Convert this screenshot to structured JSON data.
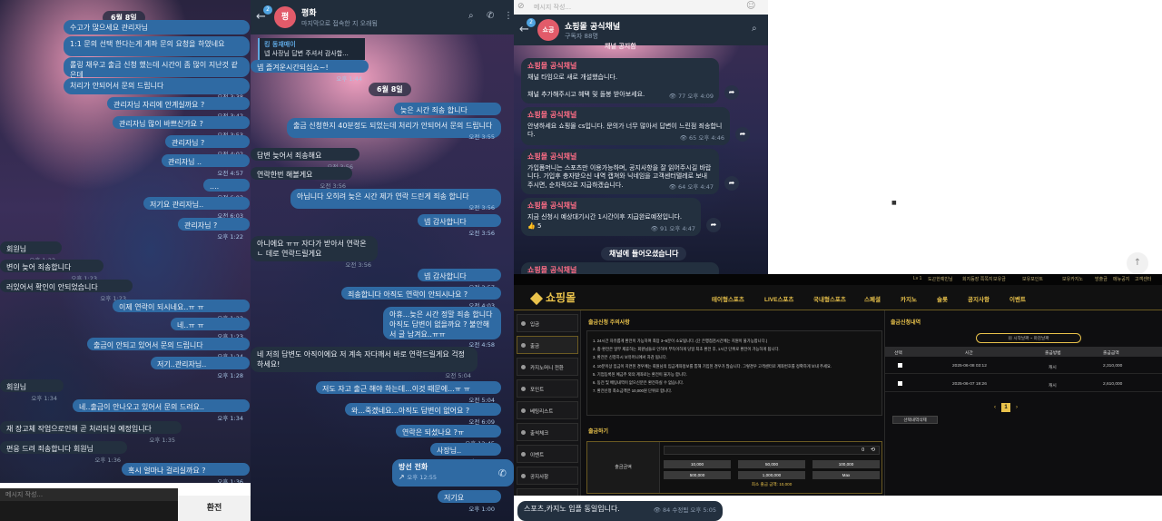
{
  "pane1": {
    "date": "6월 8일",
    "input_placeholder": "메시지 작성...",
    "exchange_button": "환전",
    "messages": [
      {
        "dir": "out",
        "text": "수고가 많으세요 관리자님",
        "time": ""
      },
      {
        "dir": "out",
        "text": "1:1 문의 선택 한다는게 계좌 문의 요청을 하였네요",
        "time": ""
      },
      {
        "dir": "out",
        "text": "롤링 채우고 출금 신청 했는데 시간이 좀 많이 지난것 같은데",
        "time": ""
      },
      {
        "dir": "out",
        "text": "처리가 안되어서 문의 드립니다",
        "time": "오전 3:38"
      },
      {
        "dir": "out",
        "text": "관리자님 자리에 안계실까요 ?",
        "time": "오전 3:42"
      },
      {
        "dir": "out",
        "text": "관리자님 많이 바쁘신가요 ?",
        "time": "오전 3:53"
      },
      {
        "dir": "out",
        "text": "관리자님 ?",
        "time": "오전 4:02"
      },
      {
        "dir": "out",
        "text": "관리자님 ..",
        "time": "오전 4:57"
      },
      {
        "dir": "out",
        "text": "....",
        "time": "오전 6:03"
      },
      {
        "dir": "out",
        "text": "저기요 관리자님..",
        "time": "오전 6:03"
      },
      {
        "dir": "out",
        "text": "관리자님 ?",
        "time": "오후 1:22"
      },
      {
        "dir": "in",
        "text": "회원님",
        "time": "오후 1:22"
      },
      {
        "dir": "in",
        "text": "변이 늦어 죄송합니다",
        "time": "오후 1:23"
      },
      {
        "dir": "in",
        "text": "러있어서 확인이 안되었습니다",
        "time": "오후 1:23"
      },
      {
        "dir": "out",
        "text": "이제 연락이 되시네요..ㅠ ㅠ",
        "time": "오후 1:23"
      },
      {
        "dir": "out",
        "text": "네..ㅠ ㅠ",
        "time": "오후 1:23"
      },
      {
        "dir": "out",
        "text": "출금이 안되고 있어서 문의 드립니다",
        "time": "오후 1:24"
      },
      {
        "dir": "out",
        "text": "저기..관리자님..",
        "time": "오후 1:28"
      },
      {
        "dir": "in",
        "text": "회원님",
        "time": "오후 1:34"
      },
      {
        "dir": "out",
        "text": "네..출금이 안나오고 있어서 문의 드려요..",
        "time": "오후 1:34"
      },
      {
        "dir": "in",
        "text": "재 장고체 작업으로인해 곧 처리되실 예정입니다",
        "time": "오후 1:35"
      },
      {
        "dir": "in",
        "text": "편응 드려 죄송합니다 회원님",
        "time": "오후 1:36"
      },
      {
        "dir": "out",
        "text": "혹시 얼마나 걸리실까요 ?",
        "time": "오후 1:36"
      }
    ]
  },
  "pane2": {
    "header_badge": "2",
    "avatar_letter": "평",
    "title": "평화",
    "subtitle": "마지막으로 접속한 지 오래됨",
    "pinned_label": "킹 동재매이",
    "pinned_text": "넵 사장님 답변 주셔서 감사합...",
    "date": "6월 8일",
    "messages": [
      {
        "dir": "out",
        "text": "넵 즐겨운시간되십쇼~!",
        "time": "오후 1:44"
      },
      {
        "dir": "out",
        "text": "늦은 시간 죄송 합니다",
        "time": "오전 3:44"
      },
      {
        "dir": "out",
        "text": "출금 신청한지 40분정도 되었는데 처리가 안되어서 문의 드립니다",
        "time": "오전 3:55"
      },
      {
        "dir": "in",
        "text": "답변 늦어서 죄송해요",
        "time": "오전 3:56"
      },
      {
        "dir": "in",
        "text": "연락한번 해볼게요",
        "time": "오전 3:56"
      },
      {
        "dir": "out",
        "text": "아닙니다 오히려 늦은 시간 제가 연락 드린게 죄송 합니다",
        "time": "오전 3:56"
      },
      {
        "dir": "out",
        "text": "넵 감사합니다",
        "time": "오전 3:56"
      },
      {
        "dir": "in",
        "text": "아니에요 ㅠㅠ 자다가 받아서 연락온ㄴ 데로 연락드릴게요",
        "time": "오전 3:56"
      },
      {
        "dir": "out",
        "text": "넵 감사합니다",
        "time": "오전 3:57"
      },
      {
        "dir": "out",
        "text": "죄송합니다 아직도 연락이 안되시나요 ?",
        "time": "오전 4:03"
      },
      {
        "dir": "out",
        "text": "아휴...늦은 시간 정말 죄송 합니다 아직도 답변이 없을까요 ? 불안해서 글 남겨요..ㅠㅠ",
        "time": "오전 4:58"
      },
      {
        "dir": "in",
        "text": "네 저희 답변도 아직이에요 저 계속 자다깨서 바로 연락드릴게요 걱정하세요!",
        "time": "오전 5:04"
      },
      {
        "dir": "out",
        "text": "저도 자고 출근 해야 하는데...이것 때문에...ㅠ ㅠ",
        "time": "오전 5:04"
      },
      {
        "dir": "out",
        "text": "와...죽겠네요...아직도 답변이 없어요 ?",
        "time": "오전 6:09"
      },
      {
        "dir": "out",
        "text": "연락은 되셨나요 ?ㅠ",
        "time": "오후 12:45"
      },
      {
        "dir": "out",
        "text": "사장님..",
        "time": "오후 12:49"
      },
      {
        "dir": "out",
        "text": "저기요",
        "time": "오후 1:00"
      }
    ],
    "call_label": "방선 전화",
    "call_time": "오후 12:55"
  },
  "pane3": {
    "header_placeholder": "메시지 작성...",
    "header_badge": "2",
    "avatar_letter": "쇼공",
    "title": "쇼핑몰 공식채널",
    "subtitle": "구독자 88명",
    "top_partial": "채널 공지함",
    "messages": [
      {
        "sender": "쇼핑몰 공식채널",
        "text": "채널 타임으로 새로 개설했습니다.\n\n채널 추가해주시고 혜택 및 돌봉 받아보세요.",
        "views": "77",
        "time": "오후 4:09"
      },
      {
        "sender": "쇼핑몰 공식채널",
        "text": "안녕하세요 쇼핑몰 cs입니다. 문의가 너무 많아서 답변이 느린점 죄송합니다.",
        "views": "65",
        "time": "오후 4:46"
      },
      {
        "sender": "쇼핑몰 공식채널",
        "text": "가입폼머니는 스포츠만 이용가능하며, 공지사항을 잘 읽어주시길 바랍니다. 가입후 충자받으신 내역 캡쳐와 닉네임을 고객센터텔레로 보내주시면, 순차적으로 지급하겠습니다.",
        "views": "64",
        "time": "오후 4:47"
      },
      {
        "sender": "쇼핑몰 공식채널",
        "text": "지금 신청시 예상대기시간 1시간이후 지급완료예정입니다.",
        "views": "91",
        "time": "오후 4:47",
        "reaction": "👍 5"
      }
    ],
    "welcome_banner": "채널에 들어오셨습니다",
    "last_sender": "쇼핑몰 공식채널",
    "bottom_text": "스포츠,카지노 입플 동일입니다.",
    "bottom_views": "84",
    "bottom_time": "수정됨 오후 5:05"
  },
  "web": {
    "topstrip": [
      "Lv 1",
      "도곤한예빈님",
      "회지등장 쪽쪽지",
      "보유금",
      "보유포인트",
      "보유카지노",
      "방출금",
      "메뉴공지",
      "고객센터"
    ],
    "logo_text": "쇼핑몰",
    "nav_items": [
      "테이형스포츠",
      "LIVE스포츠",
      "국내형스포츠",
      "스페셜",
      "카지노",
      "슬롯",
      "공지사항",
      "이벤트"
    ],
    "side_items": [
      "입금",
      "출금",
      "카지노머니 전환",
      "포인트",
      "베팅리스트",
      "출석체크",
      "이벤트",
      "공지사항",
      "쪽지"
    ],
    "active_side": 1,
    "notice_title": "출금신청 주의사항",
    "notice_lines": [
      "1. 24시간 자유롭게 환전이 가능하며 최장 3~5분이 소요됩니다. (단 은행점검시간에는 지원이 불가능합니다.)",
      "2. 충·환전은 일부 제휴하는 회원님들로 인하여 부득이하게 당일 최초 환전 후, 1시간 단위로 환전이 가능하게 됩니다.",
      "3. 환전은 신청하시 보유머니에서 차감 됩니다.",
      "4. 10분이상 입금이 지연된 경우에는 회원님의 입금계좌정보를 통해 기입된 경우가 많습니다. 그렇경우 고객센터로 계좌번호를 정확하게 보내 주세요.",
      "5. 기업등록된 예금주 외의 계좌로는 환전이 불가능 합니다.",
      "6. 동전 및 배팅내역이 없으신분은 환전하실 수 없습니다.",
      "7. 환전신청 최소금액은 10,000원 단위로 합니다."
    ],
    "withdraw_title": "출금하기",
    "form_label": "출금금액",
    "amount_value": "0",
    "amount_buttons": [
      "10,000",
      "50,000",
      "100,000",
      "500,000",
      "1,000,000",
      "Max"
    ],
    "min_amount": "최소 출금 금액: 10,000",
    "history_title": "출금신청내역",
    "date_from": "시작날짜",
    "date_to": "마감날짜",
    "table_headers": [
      "선택",
      "시간",
      "출금방법",
      "출금금액"
    ],
    "rows": [
      {
        "time": "2025-06-08 03:12",
        "method": "캐시",
        "amount": "2,310,000"
      },
      {
        "time": "2025-06-07 19:26",
        "method": "캐시",
        "amount": "2,610,000"
      }
    ],
    "current_page": "1",
    "delete_label": "선택내역삭제"
  },
  "misc_mark": "■",
  "scroll_icon": "scroll-to-top-icon"
}
